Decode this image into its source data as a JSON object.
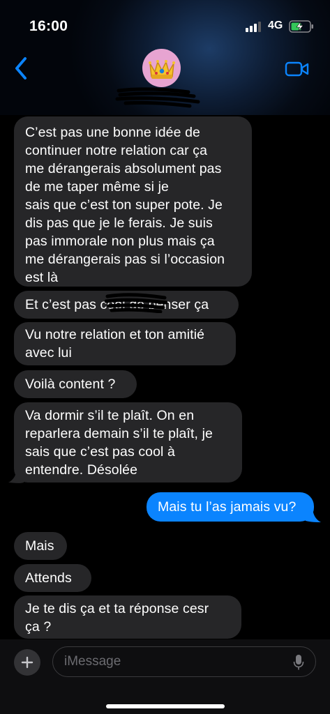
{
  "status_bar": {
    "time": "16:00",
    "network": "4G",
    "battery_icon": "battery-charging-icon",
    "signal_icon": "signal-bars-icon"
  },
  "header": {
    "back_icon": "chevron-left-icon",
    "avatar_emoji": "👑",
    "contact_name_redacted": true,
    "video_icon": "video-camera-icon",
    "accent_color": "#0b84fe"
  },
  "messages": [
    {
      "side": "received",
      "text": "C’est pas une bonne idée de\ncontinuer notre relation car ça\nme dérangerais absolument pas\nde me taper            même si je\nsais que c’est ton super pote. Je\ndis pas que je le ferais. Je suis\npas immorale non plus mais ça\nme dérangerais pas si l’occasion\nest là"
    },
    {
      "side": "received",
      "text": "Et c’est pas cool de penser ça"
    },
    {
      "side": "received",
      "text": "Vu notre relation et ton amitié\navec lui"
    },
    {
      "side": "received",
      "text": "Voilà content ?"
    },
    {
      "side": "received",
      "text": "Va dormir s’il te plaît. On en\nreparlera demain s’il te plaît, je\nsais que c’est pas cool à\nentendre. Désolée"
    },
    {
      "side": "sent",
      "text": "Mais tu l’as jamais vu?"
    },
    {
      "side": "received",
      "text": "Mais"
    },
    {
      "side": "received",
      "text": "Attends"
    },
    {
      "side": "received",
      "text": "Je te dis ça et ta réponse cesr\nça ?"
    }
  ],
  "composer": {
    "placeholder": "iMessage",
    "plus_icon": "plus-icon",
    "mic_icon": "microphone-icon"
  },
  "colors": {
    "received_bubble": "#262628",
    "sent_bubble": "#0b84fe",
    "background": "#000000"
  }
}
